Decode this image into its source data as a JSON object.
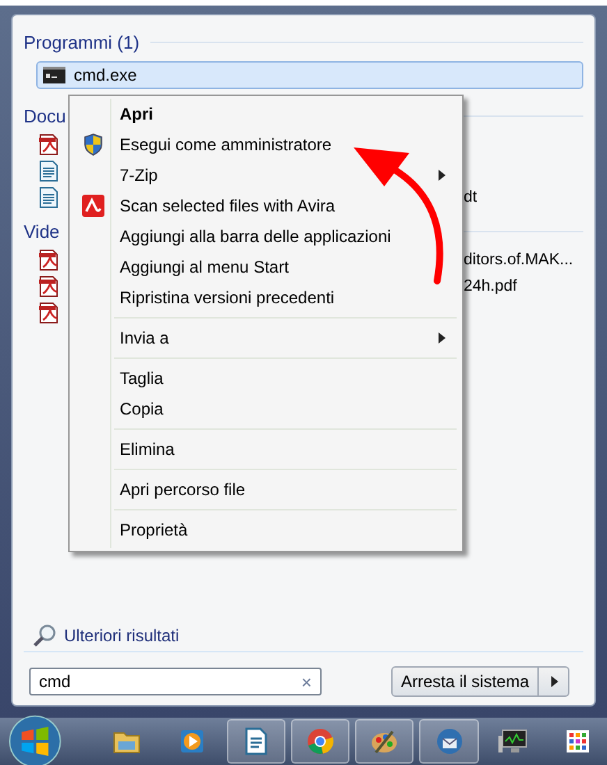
{
  "programs": {
    "header": "Programmi (1)",
    "items": [
      {
        "name": "cmd.exe",
        "selected": true
      }
    ]
  },
  "documents": {
    "header": "Docu",
    "items": [
      {
        "kind": "pdf"
      },
      {
        "kind": "doc"
      },
      {
        "kind": "doc",
        "name": "dt"
      }
    ]
  },
  "videos": {
    "header": "Vide",
    "items": [
      {
        "kind": "pdf",
        "name": "ditors.of.MAK..."
      },
      {
        "kind": "pdf",
        "name": "24h.pdf"
      },
      {
        "kind": "pdf"
      }
    ]
  },
  "context_menu": [
    {
      "kind": "item",
      "label": "Apri",
      "bold": true
    },
    {
      "kind": "shield",
      "label": "Esegui come amministratore"
    },
    {
      "kind": "item",
      "label": "7-Zip",
      "submenu": true
    },
    {
      "kind": "avira",
      "label": "Scan selected files with Avira"
    },
    {
      "kind": "item",
      "label": "Aggiungi alla barra delle applicazioni"
    },
    {
      "kind": "item",
      "label": "Aggiungi al menu Start"
    },
    {
      "kind": "item",
      "label": "Ripristina versioni precedenti"
    },
    {
      "kind": "separator"
    },
    {
      "kind": "item",
      "label": "Invia a",
      "submenu": true
    },
    {
      "kind": "separator"
    },
    {
      "kind": "item",
      "label": "Taglia"
    },
    {
      "kind": "item",
      "label": "Copia"
    },
    {
      "kind": "separator"
    },
    {
      "kind": "item",
      "label": "Elimina"
    },
    {
      "kind": "separator"
    },
    {
      "kind": "item",
      "label": "Apri percorso file"
    },
    {
      "kind": "separator"
    },
    {
      "kind": "item",
      "label": "Proprietà"
    }
  ],
  "more_results": "Ulteriori risultati",
  "search": {
    "value": "cmd",
    "clear": "×"
  },
  "shutdown_button": "Arresta il sistema",
  "taskbar": [
    {
      "kind": "folder",
      "running": false
    },
    {
      "kind": "media",
      "running": false
    },
    {
      "kind": "writer",
      "running": true
    },
    {
      "kind": "chrome",
      "running": true
    },
    {
      "kind": "paint",
      "running": true
    },
    {
      "kind": "thunderbird",
      "running": true
    },
    {
      "kind": "monitor",
      "running": false
    },
    {
      "kind": "grid",
      "running": false
    }
  ]
}
